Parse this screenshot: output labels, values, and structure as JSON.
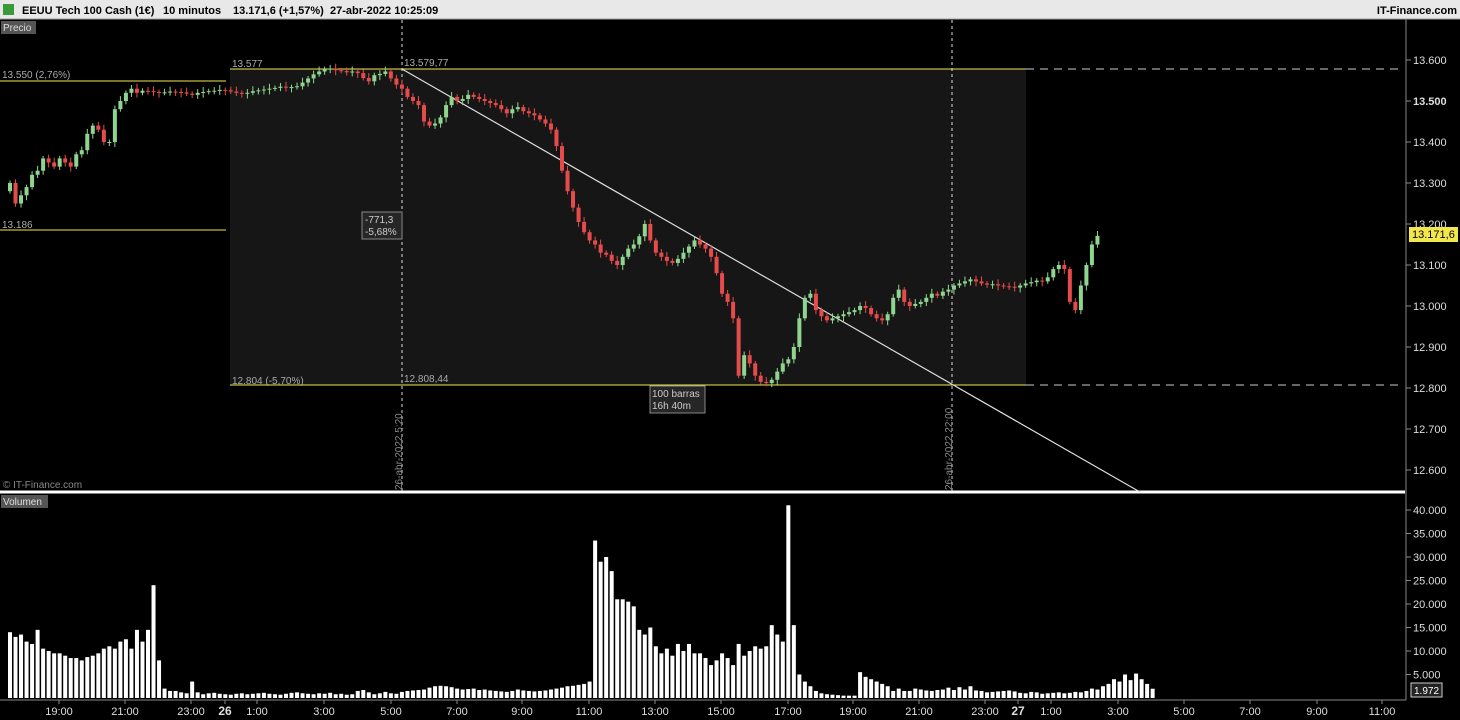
{
  "header": {
    "instrument": "EEUU Tech 100 Cash (1€)",
    "timeframe": "10 minutos",
    "last": "13.171,6 (+1,57%)",
    "datetime": "27-abr-2022 10:25:09",
    "brand": "IT-Finance.com"
  },
  "panels": {
    "price": "Precio",
    "volume": "Volumen"
  },
  "watermark": "© IT-Finance.com",
  "colors": {
    "up": "#8fd58f",
    "down": "#e64b4b",
    "background": "#000000",
    "highlight": "#161616",
    "level": "#f2e74b",
    "volume": "#ffffff"
  },
  "annotations": {
    "left_high": "13.550 (2,76%)",
    "left_low": "13.186",
    "box_high": "13.577",
    "box_high_point": "13.579,77",
    "box_low": "12.804 (-5,70%)",
    "box_low_point": "12.808,44",
    "change": [
      "-771,3",
      "-5,68%"
    ],
    "bars": [
      "100 barras",
      "16h 40m"
    ],
    "vline1": "26-abr-2022 5:20",
    "vline2": "26-abr-2022 22:00"
  },
  "last_price_tag": "13.171,6",
  "last_volume_tag": "1.972",
  "chart_data": {
    "type": "candlestick",
    "x_ticks": [
      "19:00",
      "21:00",
      "23:00",
      "26",
      "1:00",
      "3:00",
      "5:00",
      "7:00",
      "9:00",
      "11:00",
      "13:00",
      "15:00",
      "17:00",
      "19:00",
      "21:00",
      "23:00",
      "27",
      "1:00",
      "3:00",
      "5:00",
      "7:00",
      "9:00",
      "11:00"
    ],
    "price_axis": {
      "ticks": [
        "13.600",
        "13.500",
        "13.400",
        "13.300",
        "13.200",
        "13.100",
        "13.000",
        "12.900",
        "12.800",
        "12.700",
        "12.600"
      ],
      "range": [
        12550,
        13650
      ]
    },
    "volume_axis": {
      "ticks": [
        "40.000",
        "35.000",
        "30.000",
        "25.000",
        "20.000",
        "15.000",
        "10.000",
        "5.000"
      ],
      "range": [
        0,
        43000
      ]
    },
    "key_levels": [
      13550,
      13186,
      13577,
      12804
    ],
    "closes": [
      13300,
      13250,
      13270,
      13290,
      13320,
      13330,
      13360,
      13350,
      13340,
      13360,
      13350,
      13340,
      13370,
      13380,
      13420,
      13440,
      13430,
      13400,
      13400,
      13480,
      13500,
      13520,
      13530,
      13520,
      13525,
      13524,
      13522,
      13520,
      13521,
      13523,
      13522,
      13521,
      13518,
      13515,
      13520,
      13522,
      13524,
      13525,
      13527,
      13526,
      13523,
      13520,
      13518,
      13520,
      13524,
      13526,
      13528,
      13530,
      13532,
      13535,
      13533,
      13534,
      13536,
      13545,
      13555,
      13565,
      13572,
      13578,
      13579,
      13575,
      13573,
      13570,
      13572,
      13568,
      13556,
      13548,
      13563,
      13566,
      13572,
      13555,
      13540,
      13530,
      13510,
      13500,
      13490,
      13450,
      13440,
      13445,
      13460,
      13490,
      13510,
      13500,
      13505,
      13515,
      13510,
      13505,
      13500,
      13495,
      13490,
      13480,
      13470,
      13480,
      13485,
      13475,
      13470,
      13465,
      13455,
      13445,
      13430,
      13390,
      13330,
      13280,
      13240,
      13205,
      13180,
      13160,
      13150,
      13130,
      13125,
      13110,
      13100,
      13120,
      13140,
      13150,
      13170,
      13200,
      13160,
      13130,
      13120,
      13110,
      13105,
      13115,
      13130,
      13145,
      13160,
      13150,
      13140,
      13120,
      13080,
      13030,
      13010,
      12970,
      12830,
      12880,
      12860,
      12830,
      12815,
      12812,
      12820,
      12840,
      12860,
      12870,
      12900,
      12970,
      13020,
      13030,
      12990,
      12975,
      12965,
      12970,
      12975,
      12980,
      12985,
      12990,
      13000,
      12995,
      12980,
      12970,
      12965,
      12980,
      13020,
      13040,
      13010,
      13000,
      13005,
      13010,
      13020,
      13030,
      13025,
      13035,
      13040,
      13050,
      13055,
      13060,
      13065,
      13060,
      13055,
      13052,
      13053,
      13050,
      13048,
      13047,
      13045,
      13050,
      13055,
      13058,
      13062,
      13060,
      13070,
      13090,
      13100,
      13090,
      13010,
      12990,
      13050,
      13100,
      13150,
      13171
    ],
    "volumes": [
      14000,
      13000,
      13500,
      12000,
      11500,
      14500,
      10500,
      10000,
      9500,
      9500,
      9000,
      8500,
      8500,
      8000,
      8700,
      9000,
      9500,
      10500,
      11000,
      10500,
      12000,
      12500,
      10500,
      14500,
      12000,
      14500,
      24000,
      8000,
      2000,
      1500,
      1500,
      1200,
      1000,
      3500,
      1200,
      800,
      1000,
      1100,
      900,
      800,
      700,
      900,
      1000,
      800,
      900,
      1000,
      1100,
      900,
      800,
      700,
      900,
      1100,
      1200,
      1000,
      900,
      800,
      1000,
      900,
      1100,
      800,
      900,
      700,
      800,
      1500,
      1700,
      1200,
      800,
      1000,
      1300,
      1000,
      900,
      1300,
      1500,
      1600,
      1700,
      1800,
      2200,
      2500,
      2600,
      2500,
      2300,
      2000,
      1800,
      1900,
      2000,
      1700,
      1800,
      1600,
      1500,
      1400,
      1300,
      1500,
      1800,
      1600,
      1500,
      1400,
      1500,
      1600,
      1800,
      2000,
      2200,
      2500,
      2600,
      2800,
      3000,
      3500,
      33500,
      29000,
      30000,
      27000,
      21000,
      21000,
      20500,
      19500,
      14500,
      13500,
      15000,
      11000,
      9500,
      10500,
      9000,
      11500,
      10000,
      11500,
      9500,
      9500,
      8500,
      7000,
      8000,
      9500,
      8500,
      7000,
      11500,
      9000,
      10000,
      11000,
      10500,
      11000,
      15500,
      13500,
      12000,
      41000,
      15500,
      5000,
      3500,
      2500,
      1500,
      1000,
      800,
      700,
      600,
      500,
      500,
      500,
      5500,
      4500,
      4000,
      3500,
      3000,
      2500,
      1500,
      2000,
      1500,
      1500,
      2000,
      1800,
      1600,
      1500,
      1700,
      1800,
      2200,
      1700,
      2300,
      1800,
      2500,
      1600,
      1500,
      1200,
      1300,
      1400,
      1500,
      1600,
      1400,
      1100,
      1000,
      1300,
      1200,
      900,
      1000,
      1100,
      1200,
      1000,
      1100,
      1300,
      1200,
      1500,
      2000,
      1800,
      2500,
      3000,
      4000,
      3500,
      5000,
      3800,
      5200,
      4000,
      3000,
      1972
    ]
  }
}
